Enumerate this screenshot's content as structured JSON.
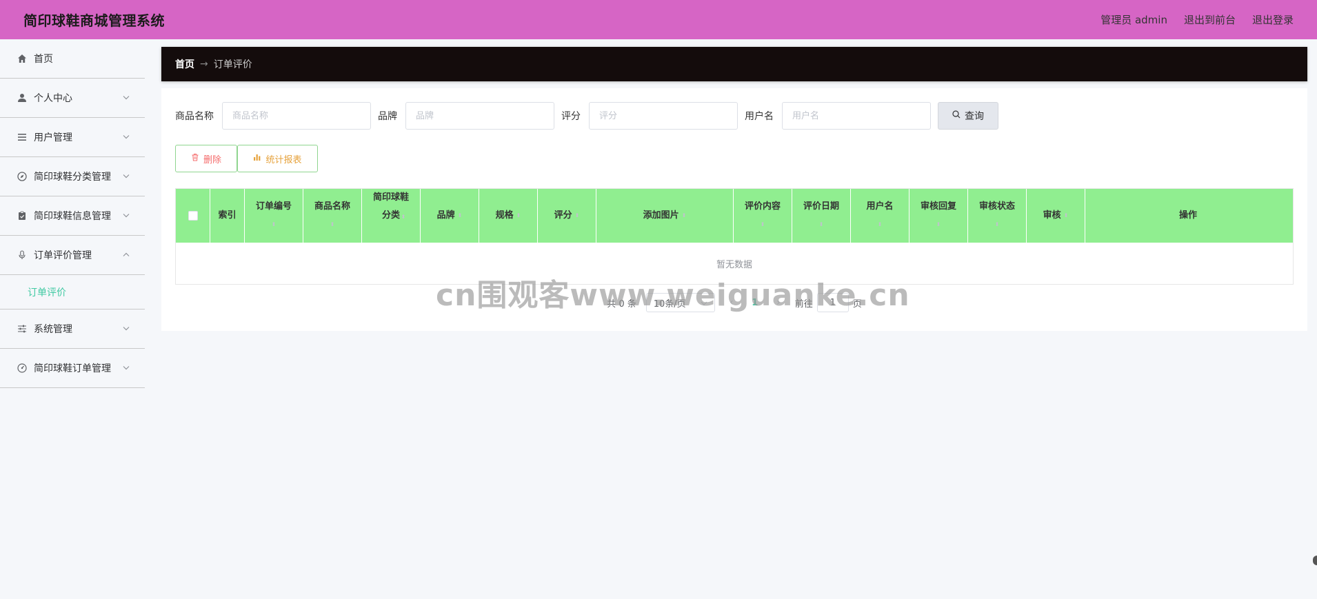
{
  "header": {
    "title": "简印球鞋商城管理系统",
    "admin_label": "管理员 admin",
    "to_front": "退出到前台",
    "logout": "退出登录"
  },
  "sidebar": {
    "items": [
      {
        "label": "首页",
        "icon": "home-icon",
        "has_children": false
      },
      {
        "label": "个人中心",
        "icon": "user-icon",
        "has_children": true
      },
      {
        "label": "用户管理",
        "icon": "list-icon",
        "has_children": true
      },
      {
        "label": "简印球鞋分类管理",
        "icon": "compass-icon",
        "has_children": true
      },
      {
        "label": "简印球鞋信息管理",
        "icon": "clipboard-icon",
        "has_children": true
      },
      {
        "label": "订单评价管理",
        "icon": "microphone-icon",
        "has_children": true,
        "expanded": true
      },
      {
        "label": "系统管理",
        "icon": "sliders-icon",
        "has_children": true
      },
      {
        "label": "简印球鞋订单管理",
        "icon": "gauge-icon",
        "has_children": true
      }
    ],
    "subitem_active": "订单评价"
  },
  "breadcrumb": {
    "home": "首页",
    "separator": "→",
    "current": "订单评价"
  },
  "search": {
    "fields": [
      {
        "label": "商品名称",
        "placeholder": "商品名称"
      },
      {
        "label": "品牌",
        "placeholder": "品牌"
      },
      {
        "label": "评分",
        "placeholder": "评分"
      },
      {
        "label": "用户名",
        "placeholder": "用户名"
      }
    ],
    "query_label": "查询"
  },
  "actions": {
    "delete_label": "删除",
    "stats_label": "统计报表"
  },
  "table": {
    "columns": [
      {
        "label": "",
        "sortable": false
      },
      {
        "label": "索引",
        "sortable": false
      },
      {
        "label": "订单编号",
        "sortable": true
      },
      {
        "label": "商品名称",
        "sortable": true
      },
      {
        "label": "简印球鞋分类",
        "sortable": true
      },
      {
        "label": "品牌",
        "sortable": true
      },
      {
        "label": "规格",
        "sortable": true
      },
      {
        "label": "评分",
        "sortable": true
      },
      {
        "label": "添加图片",
        "sortable": true
      },
      {
        "label": "评价内容",
        "sortable": true
      },
      {
        "label": "评价日期",
        "sortable": true
      },
      {
        "label": "用户名",
        "sortable": true
      },
      {
        "label": "审核回复",
        "sortable": true
      },
      {
        "label": "审核状态",
        "sortable": true
      },
      {
        "label": "审核",
        "sortable": true
      },
      {
        "label": "操作",
        "sortable": false
      }
    ],
    "empty_text": "暂无数据"
  },
  "pagination": {
    "total": "共 0 条",
    "page_size": "10条/页",
    "current_page": "1",
    "goto_prefix": "前往",
    "goto_value": "1",
    "goto_suffix": "页"
  },
  "watermark": "cn围观客www.weiguanke.cn",
  "colors": {
    "header_bg": "#d665c5",
    "breadcrumb_bg": "#140c0c",
    "table_header_bg": "#90ee90",
    "accent": "#40c9a2"
  }
}
